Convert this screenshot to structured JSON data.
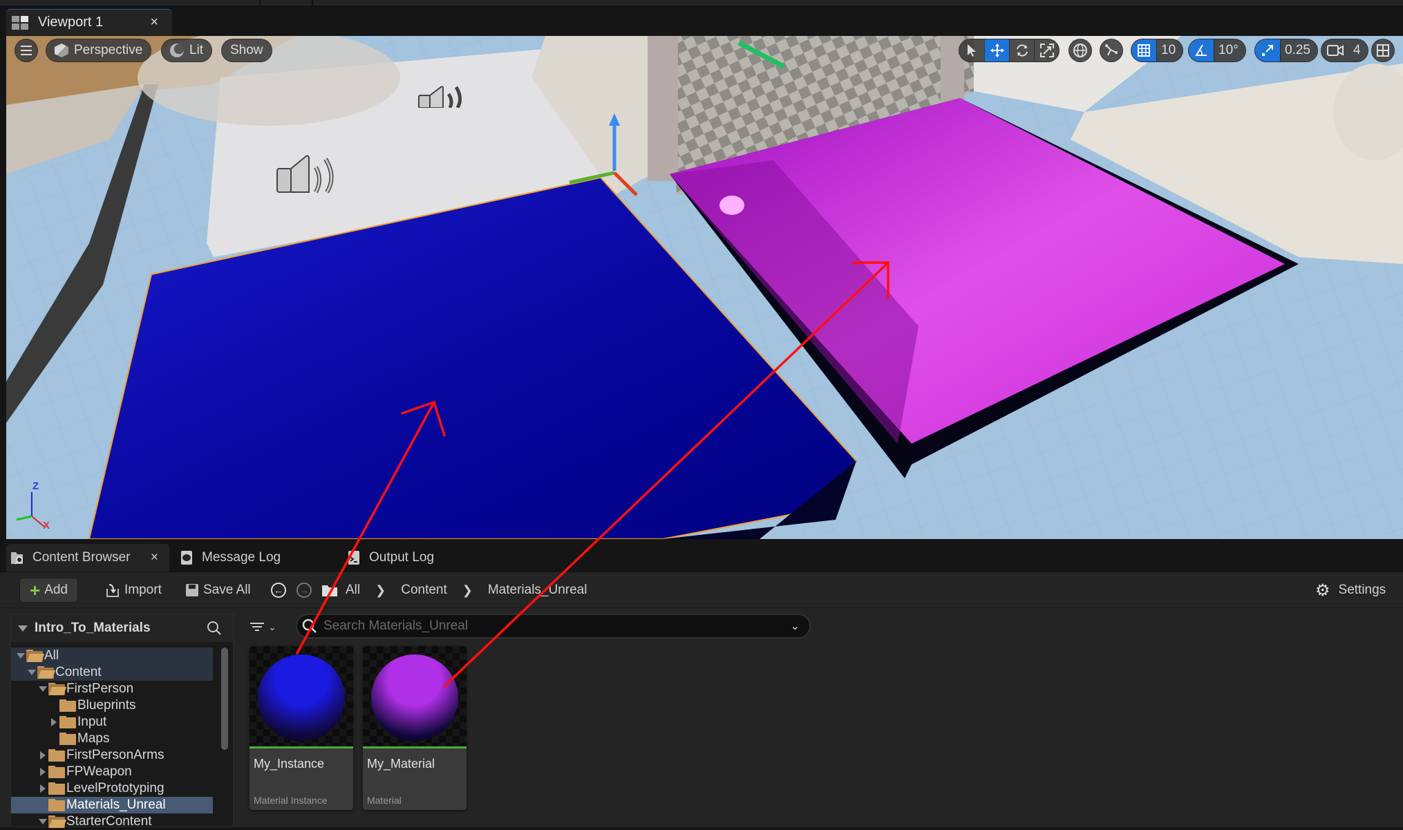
{
  "viewport_tab": {
    "title": "Viewport 1",
    "close": "×",
    "icon": "viewport-grid-icon"
  },
  "viewport_toolbar": {
    "menu_icon": "hamburger-menu-icon",
    "perspective_label": "Perspective",
    "lit_label": "Lit",
    "show_label": "Show",
    "transform_tools": [
      {
        "name": "select",
        "icon": "cursor-arrow-icon",
        "active": false
      },
      {
        "name": "translate",
        "icon": "move-arrows-icon",
        "active": true
      },
      {
        "name": "rotate",
        "icon": "rotate-icon",
        "active": false
      },
      {
        "name": "scale",
        "icon": "scale-icon",
        "active": false
      }
    ],
    "coord_system_icon": "globe-icon",
    "surface_snap_icon": "surface-snap-icon",
    "grid_snap_value": "10",
    "rotation_snap_value": "10°",
    "scale_snap_value": "0.25",
    "camera_speed_value": "4",
    "layout_icon": "viewport-layout-icon",
    "snap_active_color": "#1f74d8"
  },
  "scene": {
    "blue_material_color": "#0a0aa8",
    "magenta_material_color": "#c818d8",
    "selection_outline_color": "#f0a030",
    "annotation_arrow_color": "#ff1010",
    "axis_labels": {
      "z": "Z",
      "x": "X"
    }
  },
  "panel_tabs": [
    {
      "label": "Content Browser",
      "icon": "content-browser-icon",
      "active": true,
      "close": "×"
    },
    {
      "label": "Message Log",
      "icon": "message-log-icon",
      "active": false
    },
    {
      "label": "Output Log",
      "icon": "output-log-icon",
      "active": false
    }
  ],
  "cb_toolbar": {
    "add_label": "Add",
    "import_label": "Import",
    "save_all_label": "Save All",
    "breadcrumb": [
      "All",
      "Content",
      "Materials_Unreal"
    ],
    "settings_label": "Settings"
  },
  "tree": {
    "header": "Intro_To_Materials",
    "items": [
      {
        "label": "All",
        "depth": 0,
        "expander": "open",
        "folder": "open",
        "state": "hl"
      },
      {
        "label": "Content",
        "depth": 1,
        "expander": "open",
        "folder": "open",
        "state": "hl"
      },
      {
        "label": "FirstPerson",
        "depth": 2,
        "expander": "open",
        "folder": "open",
        "state": ""
      },
      {
        "label": "Blueprints",
        "depth": 3,
        "expander": "none",
        "folder": "closed",
        "state": ""
      },
      {
        "label": "Input",
        "depth": 3,
        "expander": "closed",
        "folder": "closed",
        "state": ""
      },
      {
        "label": "Maps",
        "depth": 3,
        "expander": "none",
        "folder": "closed",
        "state": ""
      },
      {
        "label": "FirstPersonArms",
        "depth": 2,
        "expander": "closed",
        "folder": "closed",
        "state": ""
      },
      {
        "label": "FPWeapon",
        "depth": 2,
        "expander": "closed",
        "folder": "closed",
        "state": ""
      },
      {
        "label": "LevelPrototyping",
        "depth": 2,
        "expander": "closed",
        "folder": "closed",
        "state": ""
      },
      {
        "label": "Materials_Unreal",
        "depth": 2,
        "expander": "none",
        "folder": "closed",
        "state": "sel"
      },
      {
        "label": "StarterContent",
        "depth": 2,
        "expander": "open",
        "folder": "open",
        "state": ""
      }
    ]
  },
  "search": {
    "placeholder": "Search Materials_Unreal",
    "value": ""
  },
  "assets": [
    {
      "name": "My_Instance",
      "type": "Material Instance",
      "color": "#1a1ae0"
    },
    {
      "name": "My_Material",
      "type": "Material",
      "color": "#b030e8"
    }
  ]
}
